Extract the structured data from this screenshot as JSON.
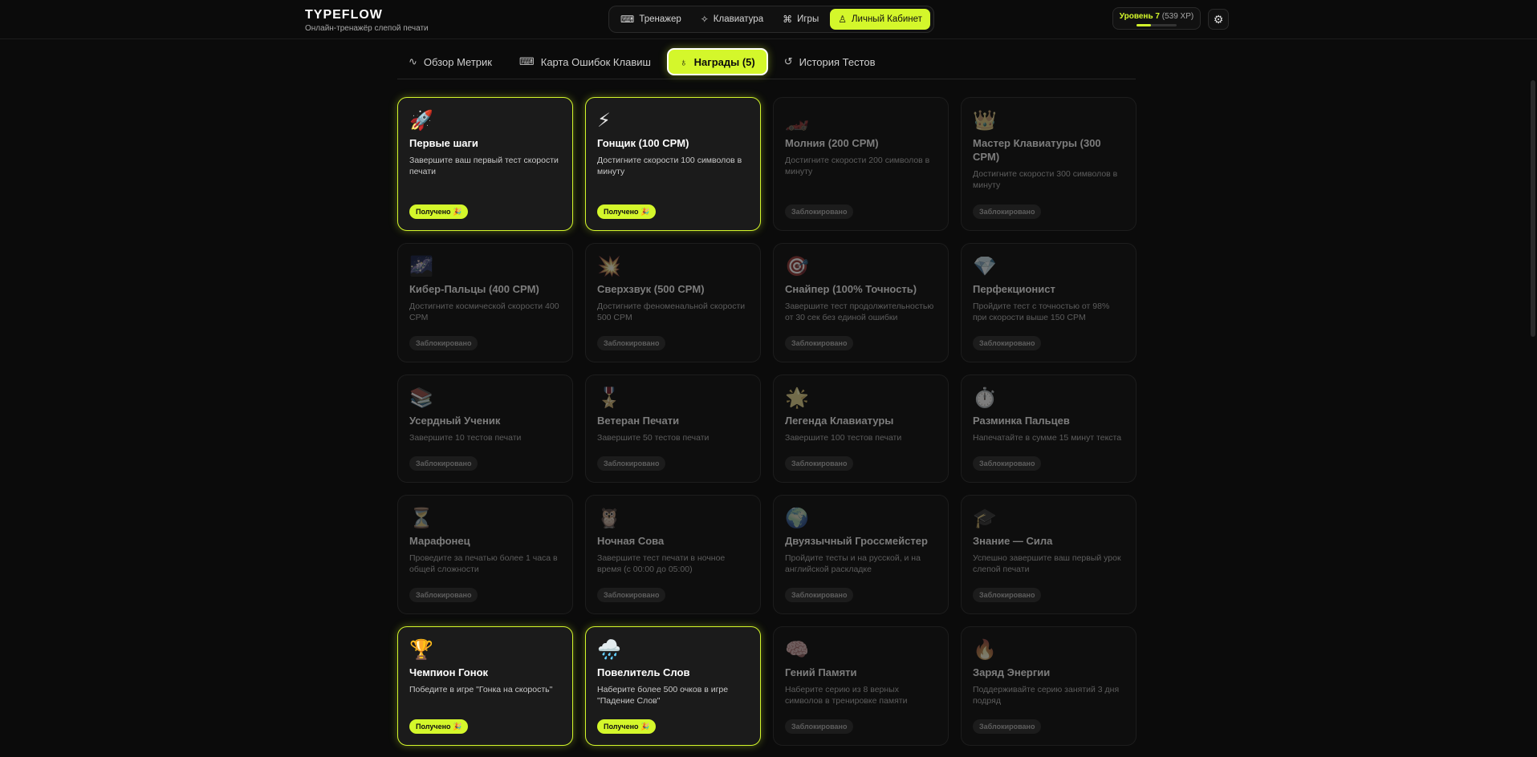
{
  "app": {
    "title": "TYPEFLOW",
    "subtitle": "Онлайн-тренажёр слепой печати"
  },
  "topnav": {
    "items": [
      {
        "label": "Тренажер",
        "icon": "keyboard-icon",
        "active": false
      },
      {
        "label": "Клавиатура",
        "icon": "sparkles-icon",
        "active": false
      },
      {
        "label": "Игры",
        "icon": "gamepad-icon",
        "active": false
      },
      {
        "label": "Личный Кабинет",
        "icon": "user-icon",
        "active": true
      }
    ]
  },
  "level": {
    "label": "Уровень 7",
    "xp": "(539 XP)",
    "progress": 0.35
  },
  "settings": {
    "icon": "gear-icon"
  },
  "tabs": [
    {
      "label": "Обзор Метрик",
      "icon": "activity-icon",
      "active": false
    },
    {
      "label": "Карта Ошибок Клавиш",
      "icon": "keyboard-icon",
      "active": false
    },
    {
      "label": "Награды (5)",
      "icon": "award-icon",
      "active": true
    },
    {
      "label": "История Тестов",
      "icon": "history-icon",
      "active": false
    }
  ],
  "achievements": [
    {
      "emoji": "🚀",
      "title": "Первые шаги",
      "desc": "Завершите ваш первый тест скорости печати",
      "status": "Получено 🎉",
      "earned": true
    },
    {
      "emoji": "⚡",
      "title": "Гонщик (100 CPM)",
      "desc": "Достигните скорости 100 символов в минуту",
      "status": "Получено 🎉",
      "earned": true
    },
    {
      "emoji": "🏎️",
      "title": "Молния (200 CPM)",
      "desc": "Достигните скорости 200 символов в минуту",
      "status": "Заблокировано",
      "earned": false
    },
    {
      "emoji": "👑",
      "title": "Мастер Клавиатуры (300 CPM)",
      "desc": "Достигните скорости 300 символов в минуту",
      "status": "Заблокировано",
      "earned": false
    },
    {
      "emoji": "🌌",
      "title": "Кибер-Пальцы (400 CPM)",
      "desc": "Достигните космической скорости 400 CPM",
      "status": "Заблокировано",
      "earned": false
    },
    {
      "emoji": "💥",
      "title": "Сверхзвук (500 CPM)",
      "desc": "Достигните феноменальной скорости 500 CPM",
      "status": "Заблокировано",
      "earned": false
    },
    {
      "emoji": "🎯",
      "title": "Снайпер (100% Точность)",
      "desc": "Завершите тест продолжительностью от 30 сек без единой ошибки",
      "status": "Заблокировано",
      "earned": false
    },
    {
      "emoji": "💎",
      "title": "Перфекционист",
      "desc": "Пройдите тест с точностью от 98% при скорости выше 150 CPM",
      "status": "Заблокировано",
      "earned": false
    },
    {
      "emoji": "📚",
      "title": "Усердный Ученик",
      "desc": "Завершите 10 тестов печати",
      "status": "Заблокировано",
      "earned": false
    },
    {
      "emoji": "🎖️",
      "title": "Ветеран Печати",
      "desc": "Завершите 50 тестов печати",
      "status": "Заблокировано",
      "earned": false
    },
    {
      "emoji": "🌟",
      "title": "Легенда Клавиатуры",
      "desc": "Завершите 100 тестов печати",
      "status": "Заблокировано",
      "earned": false
    },
    {
      "emoji": "⏱️",
      "title": "Разминка Пальцев",
      "desc": "Напечатайте в сумме 15 минут текста",
      "status": "Заблокировано",
      "earned": false
    },
    {
      "emoji": "⏳",
      "title": "Марафонец",
      "desc": "Проведите за печатью более 1 часа в общей сложности",
      "status": "Заблокировано",
      "earned": false
    },
    {
      "emoji": "🦉",
      "title": "Ночная Сова",
      "desc": "Завершите тест печати в ночное время (с 00:00 до 05:00)",
      "status": "Заблокировано",
      "earned": false
    },
    {
      "emoji": "🌍",
      "title": "Двуязычный Гроссмейстер",
      "desc": "Пройдите тесты и на русской, и на английской раскладке",
      "status": "Заблокировано",
      "earned": false
    },
    {
      "emoji": "🎓",
      "title": "Знание — Сила",
      "desc": "Успешно завершите ваш первый урок слепой печати",
      "status": "Заблокировано",
      "earned": false
    },
    {
      "emoji": "🏆",
      "title": "Чемпион Гонок",
      "desc": "Победите в игре \"Гонка на скорость\"",
      "status": "Получено 🎉",
      "earned": true
    },
    {
      "emoji": "🌧️",
      "title": "Повелитель Слов",
      "desc": "Наберите более 500 очков в игре \"Падение Слов\"",
      "status": "Получено 🎉",
      "earned": true
    },
    {
      "emoji": "🧠",
      "title": "Гений Памяти",
      "desc": "Наберите серию из 8 верных символов в тренировке памяти",
      "status": "Заблокировано",
      "earned": false
    },
    {
      "emoji": "🔥",
      "title": "Заряд Энергии",
      "desc": "Поддерживайте серию занятий 3 дня подряд",
      "status": "Заблокировано",
      "earned": false
    }
  ]
}
